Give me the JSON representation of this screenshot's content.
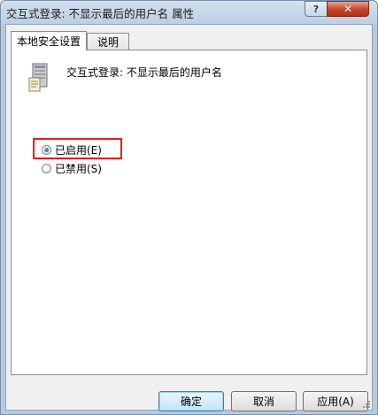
{
  "window": {
    "title": "交互式登录: 不显示最后的用户名 属性",
    "help_label": "?",
    "close_label": "✕"
  },
  "tabs": [
    {
      "label": "本地安全设置",
      "active": true
    },
    {
      "label": "说明",
      "active": false
    }
  ],
  "policy": {
    "icon": "server-icon",
    "name": "交互式登录: 不显示最后的用户名"
  },
  "options": [
    {
      "label": "已启用(E)",
      "selected": true,
      "highlighted": true
    },
    {
      "label": "已禁用(S)",
      "selected": false,
      "highlighted": false
    }
  ],
  "buttons": {
    "ok": "确定",
    "cancel": "取消",
    "apply": "应用(A)"
  },
  "colors": {
    "highlight_border": "#e02020",
    "close_button": "#c5432a",
    "window_frame": "#b6c9de"
  }
}
